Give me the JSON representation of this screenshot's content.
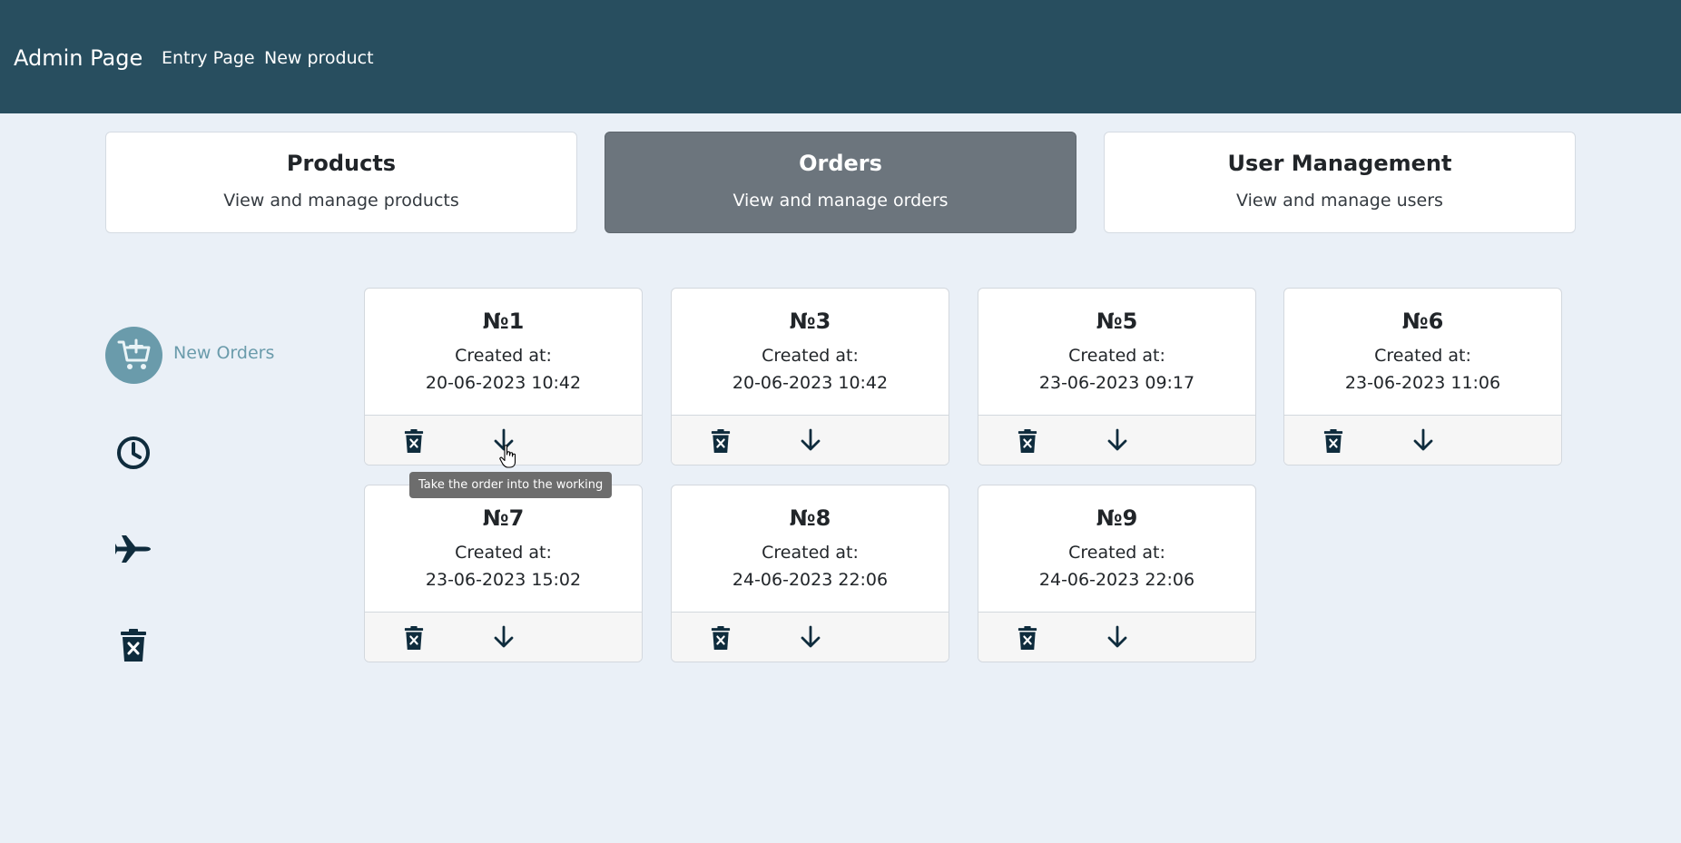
{
  "navbar": {
    "brand": "Admin Page",
    "links": [
      "Entry Page",
      "New product"
    ],
    "bg_color": "#284e5f"
  },
  "sections": [
    {
      "title": "Products",
      "subtitle": "View and manage products",
      "active": false
    },
    {
      "title": "Orders",
      "subtitle": "View and manage orders",
      "active": true
    },
    {
      "title": "User Management",
      "subtitle": "View and manage users",
      "active": false
    }
  ],
  "status_menu": [
    {
      "label": "New Orders",
      "icon": "cart-plus-icon",
      "active": true
    },
    {
      "label": "",
      "icon": "clock-icon",
      "active": false
    },
    {
      "label": "",
      "icon": "airplane-icon",
      "active": false
    },
    {
      "label": "",
      "icon": "trash-icon",
      "active": false
    }
  ],
  "orders": {
    "created_label": "Created at:",
    "items": [
      {
        "number": "№1",
        "created_at": "20-06-2023 10:42"
      },
      {
        "number": "№3",
        "created_at": "20-06-2023 10:42"
      },
      {
        "number": "№5",
        "created_at": "23-06-2023 09:17"
      },
      {
        "number": "№6",
        "created_at": "23-06-2023 11:06"
      },
      {
        "number": "№7",
        "created_at": "23-06-2023 15:02"
      },
      {
        "number": "№8",
        "created_at": "24-06-2023 22:06"
      },
      {
        "number": "№9",
        "created_at": "24-06-2023 22:06"
      }
    ],
    "action_icons": [
      "trash-icon",
      "arrow-down-icon"
    ]
  },
  "tooltip": {
    "text": "Take the order into the working"
  },
  "colors": {
    "accent": "#6a9bab",
    "icon": "#0f2c3d",
    "page_bg": "#eaf0f7",
    "active_section": "#6c757d"
  }
}
